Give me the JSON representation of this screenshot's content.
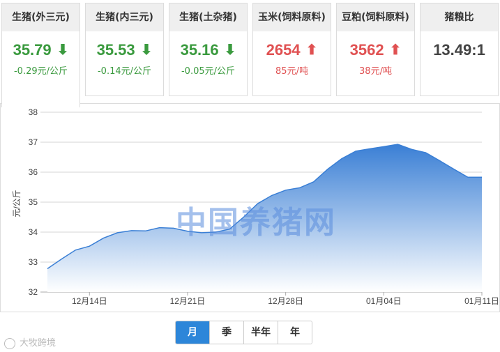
{
  "cards": [
    {
      "title": "生猪(外三元)",
      "value": "35.79",
      "direction": "down",
      "change": "-0.29元/公斤"
    },
    {
      "title": "生猪(内三元)",
      "value": "35.53",
      "direction": "down",
      "change": "-0.14元/公斤"
    },
    {
      "title": "生猪(土杂猪)",
      "value": "35.16",
      "direction": "down",
      "change": "-0.05元/公斤"
    },
    {
      "title": "玉米(饲料原料)",
      "value": "2654",
      "direction": "up",
      "change": "85元/吨"
    },
    {
      "title": "豆粕(饲料原料)",
      "value": "3562",
      "direction": "up",
      "change": "38元/吨"
    },
    {
      "title": "猪粮比",
      "value": "13.49:1",
      "direction": "none",
      "change": ""
    }
  ],
  "icons": {
    "down": "arrow-down-icon",
    "up": "arrow-up-icon"
  },
  "colors": {
    "down": "#3a9a3e",
    "up": "#e05152",
    "accent": "#2d86d9",
    "area_top": "#3a7fd5",
    "area_bottom": "#ffffff"
  },
  "watermark": "中国养猪网",
  "credit": "大牧跨境",
  "tabs": [
    {
      "label": "月",
      "active": true
    },
    {
      "label": "季",
      "active": false
    },
    {
      "label": "半年",
      "active": false
    },
    {
      "label": "年",
      "active": false
    }
  ],
  "chart_data": {
    "type": "area",
    "title": "",
    "xlabel": "",
    "ylabel": "元/公斤",
    "ylim": [
      32,
      38
    ],
    "yticks": [
      32,
      33,
      34,
      35,
      36,
      37,
      38
    ],
    "grid": true,
    "x_tick_labels": [
      "12月14日",
      "12月21日",
      "12月28日",
      "01月04日",
      "01月11日"
    ],
    "x": [
      "12月11日",
      "12月12日",
      "12月13日",
      "12月14日",
      "12月15日",
      "12月16日",
      "12月17日",
      "12月18日",
      "12月19日",
      "12月20日",
      "12月21日",
      "12月22日",
      "12月23日",
      "12月24日",
      "12月25日",
      "12月26日",
      "12月27日",
      "12月28日",
      "12月29日",
      "12月30日",
      "12月31日",
      "01月01日",
      "01月02日",
      "01月03日",
      "01月04日",
      "01月05日",
      "01月06日",
      "01月07日",
      "01月08日",
      "01月09日",
      "01月10日",
      "01月11日"
    ],
    "values": [
      32.78,
      33.1,
      33.4,
      33.53,
      33.8,
      33.98,
      34.05,
      34.04,
      34.15,
      34.13,
      34.03,
      33.98,
      34.0,
      34.1,
      34.5,
      34.95,
      35.22,
      35.4,
      35.48,
      35.68,
      36.1,
      36.45,
      36.7,
      36.78,
      36.85,
      36.93,
      36.76,
      36.65,
      36.38,
      36.1,
      35.83,
      35.83
    ]
  }
}
